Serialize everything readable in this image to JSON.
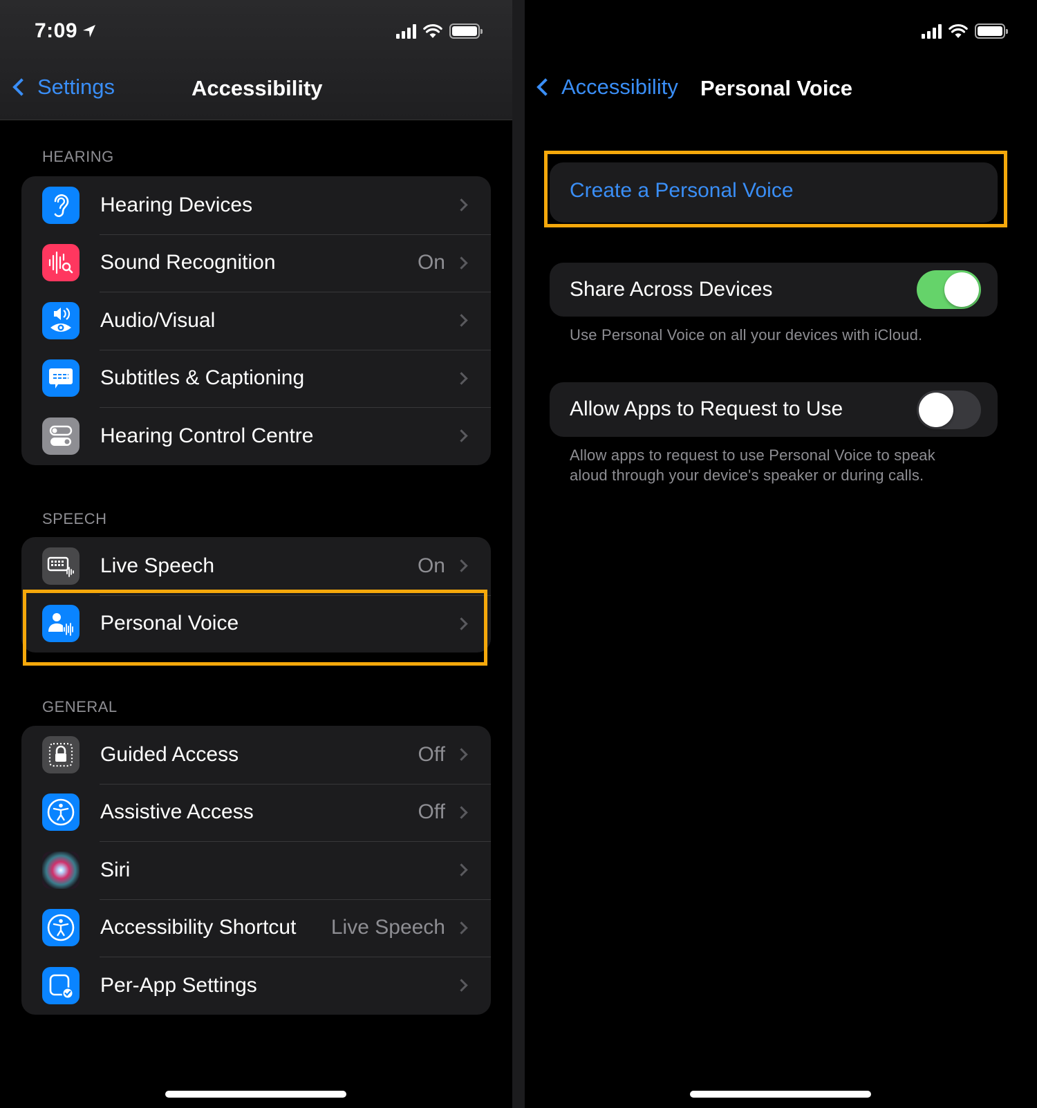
{
  "colors": {
    "accent_blue": "#3a8ef6",
    "highlight_orange": "#f5a80b",
    "toggle_on_green": "#65d36a",
    "icon_blue": "#0a84ff",
    "icon_red": "#ff375f",
    "icon_gray": "#8e8e93",
    "icon_dark_gray": "#48484a"
  },
  "left": {
    "status_bar": {
      "time": "7:09",
      "location_icon": "location-arrow-icon"
    },
    "nav": {
      "back_label": "Settings",
      "title": "Accessibility"
    },
    "sections": [
      {
        "header": "HEARING",
        "items": [
          {
            "label": "Hearing Devices",
            "value": "",
            "icon": "ear-icon"
          },
          {
            "label": "Sound Recognition",
            "value": "On",
            "icon": "sound-recognition-icon"
          },
          {
            "label": "Audio/Visual",
            "value": "",
            "icon": "audio-visual-icon"
          },
          {
            "label": "Subtitles & Captioning",
            "value": "",
            "icon": "captions-icon"
          },
          {
            "label": "Hearing Control Centre",
            "value": "",
            "icon": "control-centre-icon"
          }
        ]
      },
      {
        "header": "SPEECH",
        "items": [
          {
            "label": "Live Speech",
            "value": "On",
            "icon": "keyboard-waveform-icon"
          },
          {
            "label": "Personal Voice",
            "value": "",
            "icon": "person-waveform-icon",
            "highlighted": true
          }
        ]
      },
      {
        "header": "GENERAL",
        "items": [
          {
            "label": "Guided Access",
            "value": "Off",
            "icon": "lock-dotted-icon"
          },
          {
            "label": "Assistive Access",
            "value": "Off",
            "icon": "accessibility-icon"
          },
          {
            "label": "Siri",
            "value": "",
            "icon": "siri-icon"
          },
          {
            "label": "Accessibility Shortcut",
            "value": "Live Speech",
            "icon": "accessibility-icon"
          },
          {
            "label": "Per-App Settings",
            "value": "",
            "icon": "per-app-icon"
          }
        ]
      }
    ]
  },
  "right": {
    "nav": {
      "back_label": "Accessibility",
      "title": "Personal Voice"
    },
    "create_button": {
      "label": "Create a Personal Voice",
      "highlighted": true
    },
    "share_across_devices": {
      "label": "Share Across Devices",
      "enabled": true,
      "description": "Use Personal Voice on all your devices with iCloud."
    },
    "allow_apps": {
      "label": "Allow Apps to Request to Use",
      "enabled": false,
      "description_line1": "Allow apps to request to use Personal Voice to speak",
      "description_line2": "aloud through your device's speaker or during calls."
    }
  }
}
